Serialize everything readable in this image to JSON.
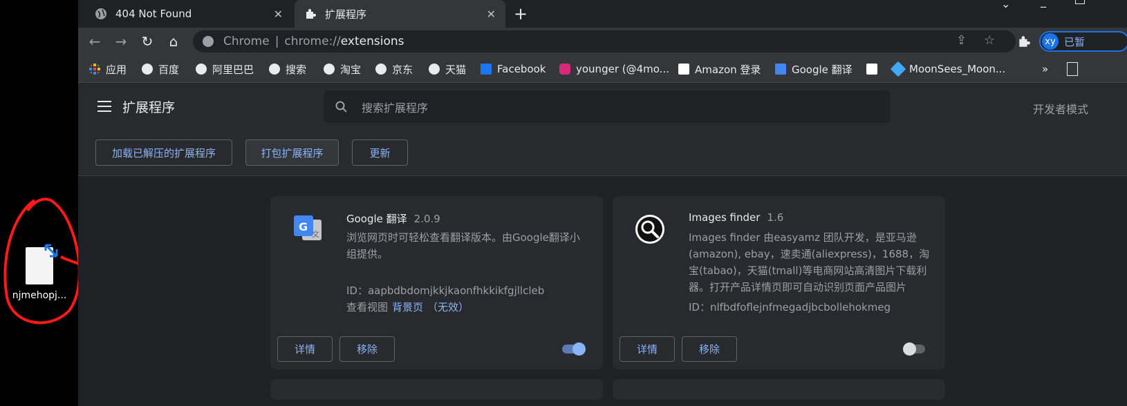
{
  "desktop": {
    "file_name": "njmehopj..."
  },
  "tabs": [
    {
      "title": "404 Not Found",
      "active": false
    },
    {
      "title": "扩展程序",
      "active": true
    }
  ],
  "toolbar": {
    "omnibox_label": "Chrome",
    "omnibox_sep": "|",
    "url_scheme": "chrome://",
    "url_host": "extensions",
    "profile_initials": "xy",
    "profile_text": "已暂"
  },
  "bookmarks": [
    {
      "label": "应用",
      "icon": "apps-grid-icon"
    },
    {
      "label": "百度",
      "icon": "globe-icon"
    },
    {
      "label": "阿里巴巴",
      "icon": "globe-icon"
    },
    {
      "label": "搜索",
      "icon": "globe-icon"
    },
    {
      "label": "淘宝",
      "icon": "globe-icon"
    },
    {
      "label": "京东",
      "icon": "globe-icon"
    },
    {
      "label": "天猫",
      "icon": "globe-icon"
    },
    {
      "label": "Facebook",
      "icon": "facebook-icon"
    },
    {
      "label": "younger (@4mo...",
      "icon": "instagram-icon"
    },
    {
      "label": "Amazon 登录",
      "icon": "amazon-icon"
    },
    {
      "label": "Google 翻译",
      "icon": "google-translate-icon"
    },
    {
      "label": "",
      "icon": "amazon-icon"
    },
    {
      "label": "MoonSees_Moon...",
      "icon": "diamond-icon"
    }
  ],
  "bookmarks_overflow": "»",
  "extensions_page": {
    "title": "扩展程序",
    "search_placeholder": "搜索扩展程序",
    "dev_mode_label": "开发者模式",
    "actions": {
      "load_unpacked": "加载已解压的扩展程序",
      "pack": "打包扩展程序",
      "update": "更新"
    }
  },
  "extensions": [
    {
      "name": "Google 翻译",
      "version": "2.0.9",
      "description": "浏览网页时可轻松查看翻译版本。由Google翻译小组提供。",
      "id_text": "ID：aapbdbdomjkkjkaonfhkkikfgjllcleb",
      "views_label": "查看视图",
      "views_link": "背景页",
      "views_status": "（无效）",
      "details_label": "详情",
      "remove_label": "移除",
      "enabled": true
    },
    {
      "name": "Images finder",
      "version": "1.6",
      "description": "Images finder 由easyamz 团队开发，是亚马逊(amazon), ebay，速卖通(aliexpress)，1688，淘宝(tabao)，天猫(tmall)等电商网站高清图片下载利器。打开产品详情页即可自动识别页面产品图片",
      "id_text": "ID：nlfbdfoflejnfmegadjbcbollehokmeg",
      "details_label": "详情",
      "remove_label": "移除",
      "enabled": false
    }
  ],
  "colors": {
    "accent": "#8ab4f8",
    "page_bg": "#202124",
    "card_bg": "#292a2d",
    "annotation": "#ff0000"
  }
}
